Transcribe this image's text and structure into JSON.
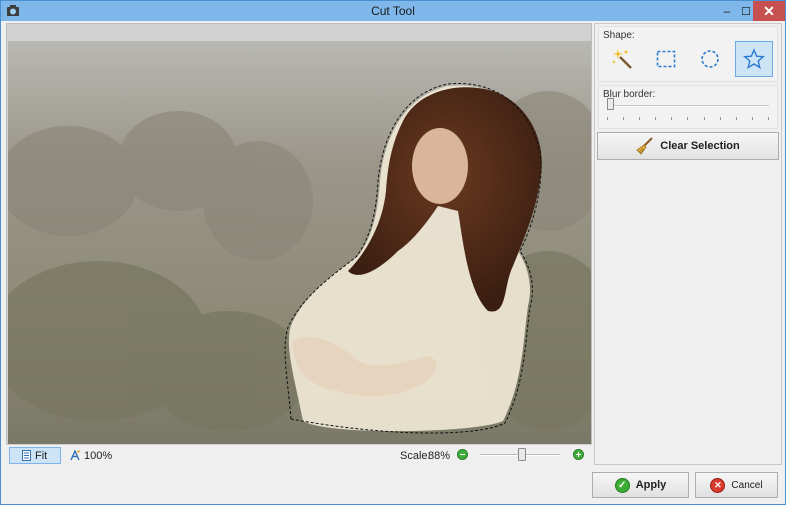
{
  "window": {
    "title": "Cut Tool",
    "minimize_glyph": "–",
    "maximize_glyph": "☐",
    "close_glyph": "✕"
  },
  "shape_panel": {
    "label": "Shape:",
    "tools": [
      {
        "name": "magic-wand",
        "icon": "magic-wand-icon",
        "active": false
      },
      {
        "name": "rectangle",
        "icon": "rectangle-select-icon",
        "active": false
      },
      {
        "name": "ellipse",
        "icon": "ellipse-select-icon",
        "active": false
      },
      {
        "name": "freeform",
        "icon": "star-icon",
        "active": true
      }
    ]
  },
  "blur_border": {
    "label": "Blur border:",
    "value_fraction": 0.0
  },
  "clear_selection": {
    "label": "Clear Selection",
    "icon": "broom-icon"
  },
  "statusbar": {
    "fit_label": "Fit",
    "zoom100_label": "100%",
    "scale_label": "Scale:",
    "scale_value": "88%",
    "zoom_slider_fraction": 0.52
  },
  "buttons": {
    "apply_label": "Apply",
    "cancel_label": "Cancel"
  },
  "colors": {
    "titlebar": "#7fb7ea",
    "close_button": "#c75050",
    "active_tool": "#cde4f7",
    "apply_icon": "#3cac35",
    "cancel_icon": "#d83b2e"
  }
}
